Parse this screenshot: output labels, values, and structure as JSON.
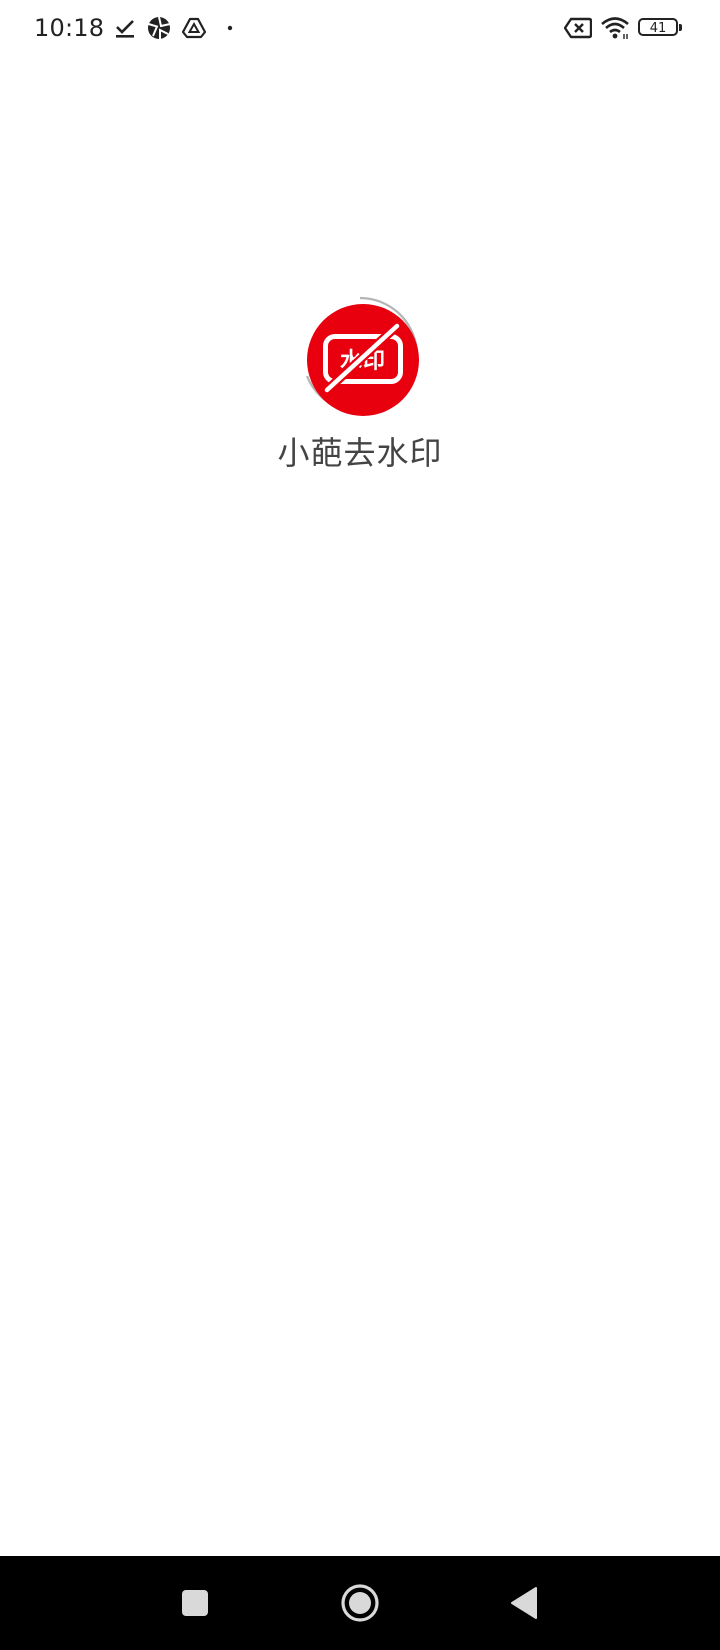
{
  "status_bar": {
    "time": "10:18",
    "battery_level": "41",
    "left_icons": [
      "check-download-icon",
      "aperture-icon",
      "drive-icon",
      "dot-icon"
    ],
    "right_icons": [
      "no-sim-icon",
      "wifi-icon",
      "battery-icon"
    ]
  },
  "splash": {
    "logo_text": "水印",
    "app_name": "小葩去水印"
  },
  "colors": {
    "logo_red": "#e8000f",
    "nav_background": "#000000",
    "nav_icon": "#d9d9d9"
  },
  "nav_bar": {
    "buttons": [
      "recents",
      "home",
      "back"
    ]
  }
}
